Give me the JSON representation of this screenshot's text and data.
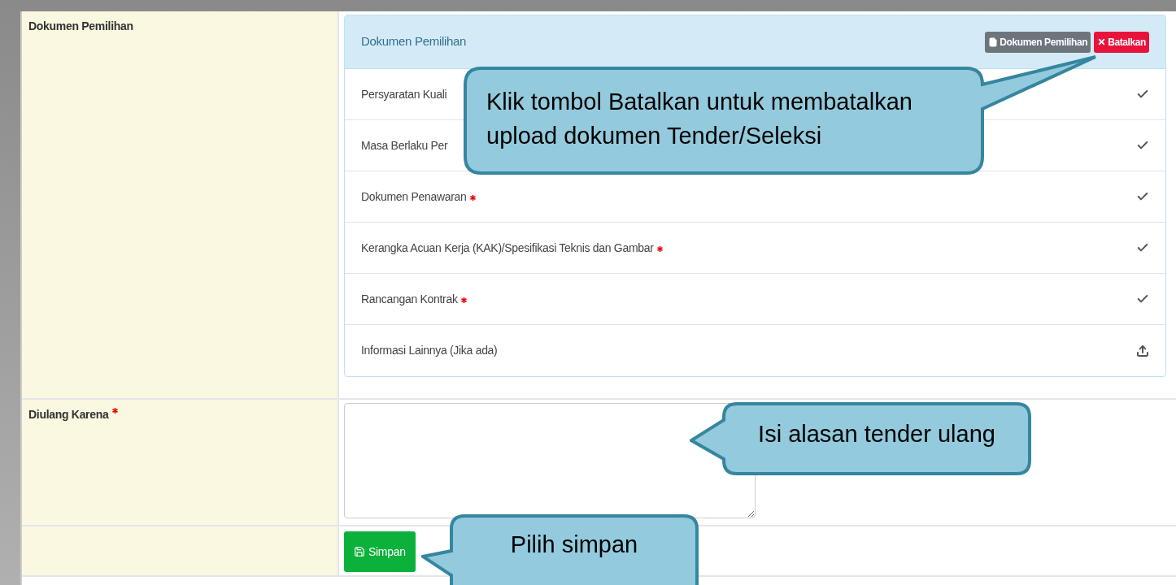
{
  "form": {
    "rows": [
      {
        "kind": "documents",
        "label": "Dokumen Pemilihan",
        "required": false,
        "panel": {
          "title": "Dokumen Pemilihan",
          "buttons": [
            {
              "kind": "document",
              "label": "Dokumen Pemilihan"
            },
            {
              "kind": "cancel",
              "label": "Batalkan"
            }
          ],
          "items": [
            {
              "name": "Persyaratan Kuali",
              "required": false,
              "uploaded": true
            },
            {
              "name": "Masa Berlaku Per",
              "required": false,
              "uploaded": true
            },
            {
              "name": "Dokumen Penawaran",
              "required": true,
              "uploaded": true
            },
            {
              "name": "Kerangka Acuan Kerja (KAK)/Spesifikasi Teknis dan Gambar",
              "required": true,
              "uploaded": true
            },
            {
              "name": "Rancangan Kontrak",
              "required": true,
              "uploaded": true
            },
            {
              "name": "Informasi Lainnya (Jika ada)",
              "required": false,
              "uploaded": false
            }
          ]
        }
      },
      {
        "kind": "textarea",
        "label": "Diulang Karena",
        "required": true
      },
      {
        "kind": "submit",
        "button": "Simpan"
      }
    ]
  },
  "callouts": [
    "Klik tombol Batalkan untuk membatalkan upload dokumen Tender/Seleksi",
    "Isi alasan tender ulang",
    "Pilih simpan"
  ]
}
